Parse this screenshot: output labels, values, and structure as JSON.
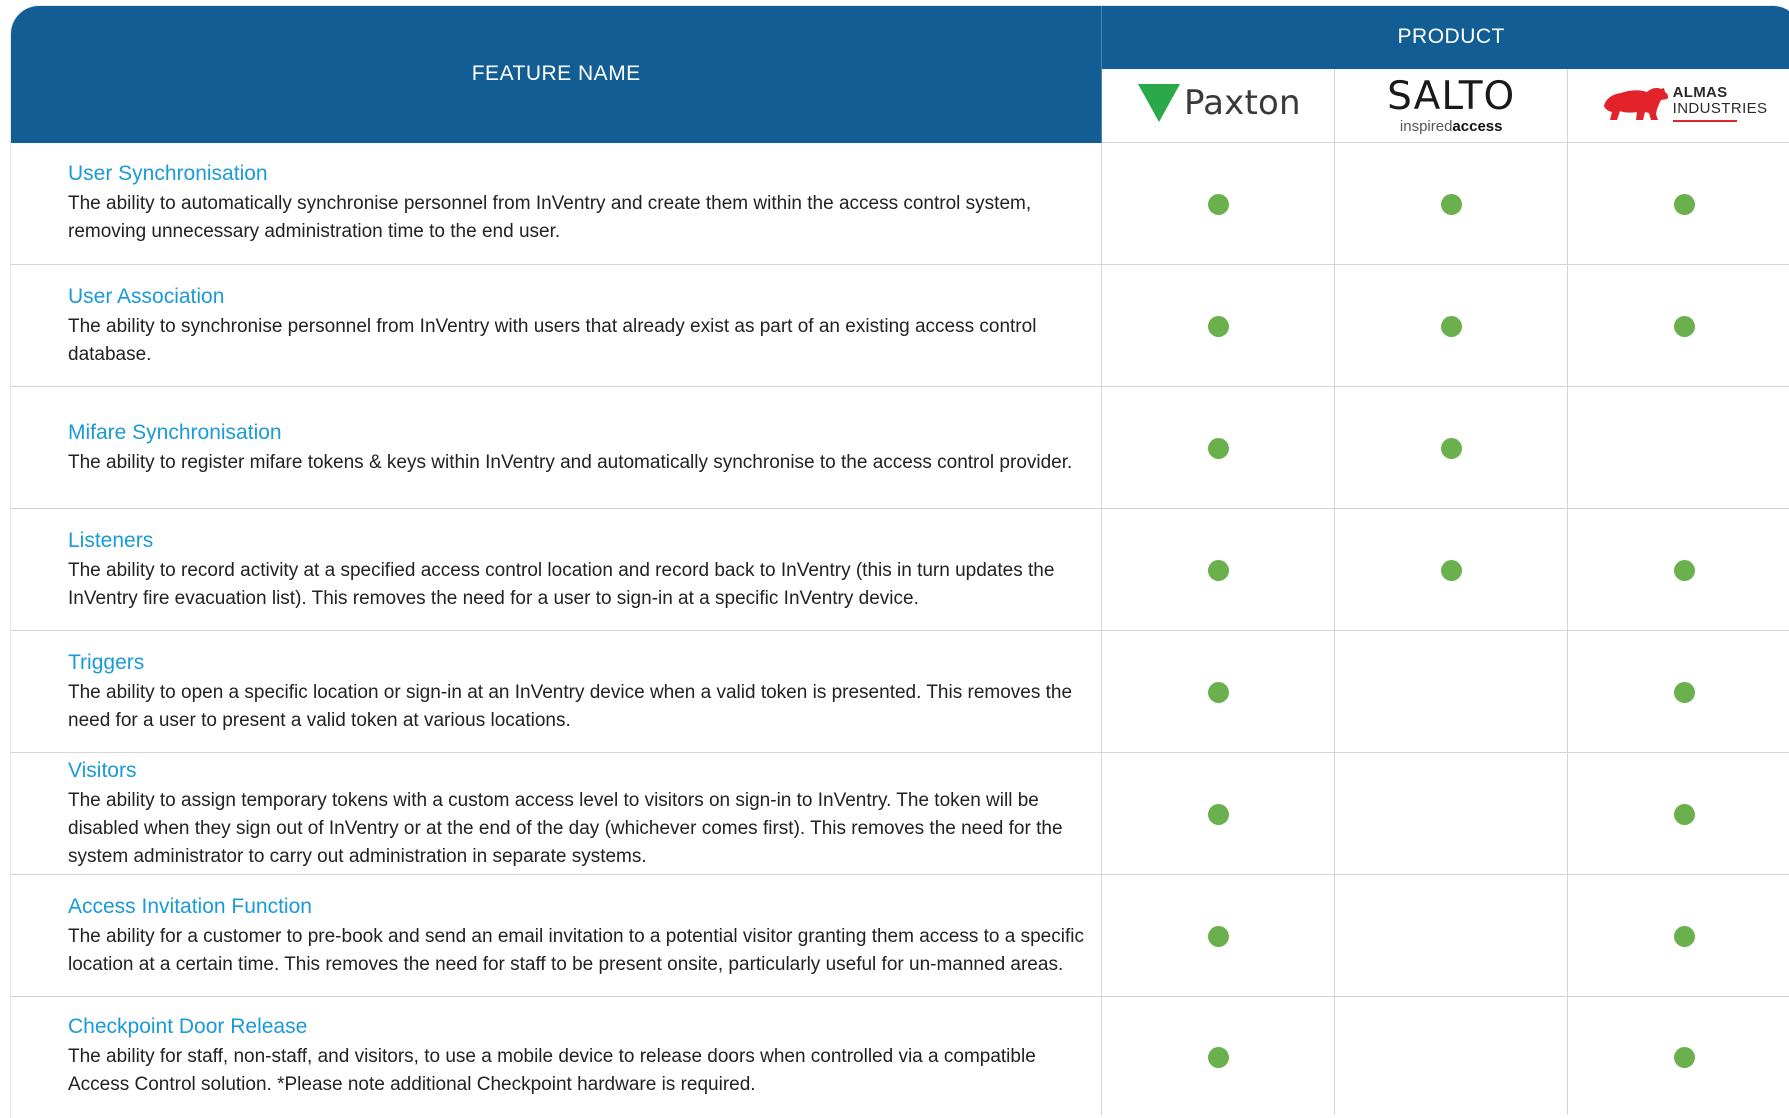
{
  "header": {
    "feature_label": "FEATURE NAME",
    "product_label": "PRODUCT"
  },
  "products": [
    {
      "name": "Paxton",
      "logo_icon": "paxton-logo-icon",
      "brand_color": "#2aa84a"
    },
    {
      "name": "SALTO",
      "tagline_light": "inspired",
      "tagline_bold": "access",
      "logo_icon": "salto-logo-icon"
    },
    {
      "name_top": "ALMAS",
      "name_bottom": "INDUSTRIES",
      "logo_icon": "almas-bear-icon",
      "brand_color": "#e3232b"
    }
  ],
  "colors": {
    "header_bg": "#125d94",
    "title_text": "#1a9ad6",
    "supported_dot": "#6ab04c"
  },
  "features": [
    {
      "title": "User Synchronisation",
      "description": "The ability to automatically synchronise personnel from InVentry and create them within the access control system, removing unnecessary administration time to the end user.",
      "support": [
        true,
        true,
        true
      ]
    },
    {
      "title": "User Association",
      "description": "The ability to synchronise personnel from InVentry with users that already exist as part of an existing access control database.",
      "support": [
        true,
        true,
        true
      ]
    },
    {
      "title": "Mifare Synchronisation",
      "description": "The ability to register mifare tokens & keys within InVentry and automatically synchronise to the access control provider.",
      "support": [
        true,
        true,
        false
      ]
    },
    {
      "title": "Listeners",
      "description": "The ability to record activity at a specified access control location and record back to InVentry (this in turn updates the InVentry fire evacuation list). This removes the need for a user to sign-in at a specific InVentry device.",
      "support": [
        true,
        true,
        true
      ]
    },
    {
      "title": "Triggers",
      "description": "The ability to open a specific location or sign-in at an InVentry device when a valid token is presented. This removes the need for a user to present a valid token at various locations.",
      "support": [
        true,
        false,
        true
      ]
    },
    {
      "title": "Visitors",
      "description": "The ability to assign temporary tokens with a custom access level to visitors on sign-in to InVentry. The token will be disabled when they sign out of InVentry or at the end of the day (whichever comes first). This removes the need for the system administrator to carry out administration in separate systems.",
      "support": [
        true,
        false,
        true
      ]
    },
    {
      "title": "Access Invitation Function",
      "description": "The ability for a customer to pre-book and send an email invitation to a potential visitor granting them access to a specific location at a certain time. This removes the need for staff to be present onsite, particularly useful for un-manned areas.",
      "support": [
        true,
        false,
        true
      ]
    },
    {
      "title": "Checkpoint Door Release",
      "description": "The ability for staff, non-staff, and visitors, to use a mobile device to release doors when controlled via a compatible Access Control solution. *Please note additional Checkpoint hardware is required.",
      "support": [
        true,
        false,
        true
      ]
    }
  ]
}
